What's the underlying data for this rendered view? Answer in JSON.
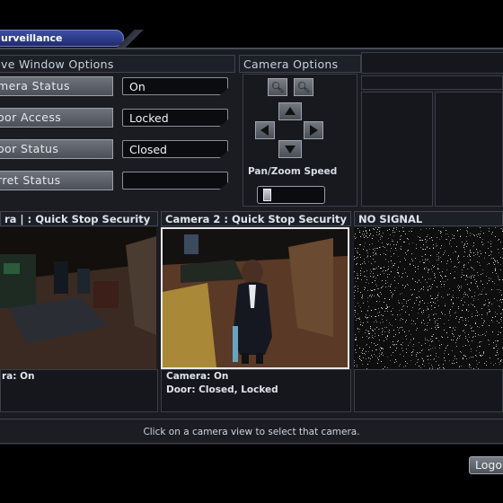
{
  "window": {
    "title": "urveillance"
  },
  "live_options": {
    "header": "ve Window Options",
    "rows": [
      {
        "label": "mera Status",
        "value": "On"
      },
      {
        "label": "oor Access",
        "value": "Locked"
      },
      {
        "label": "oor Status",
        "value": "Closed"
      },
      {
        "label": "rret Status",
        "value": ""
      }
    ]
  },
  "camera_options": {
    "header": "Camera Options",
    "zoom_in_icon": "magnifier-plus-icon",
    "zoom_out_icon": "magnifier-minus-icon",
    "speed_label": "Pan/Zoom Speed",
    "speed_level": 0.05
  },
  "cameras": [
    {
      "title": "ra | : Quick Stop Security",
      "status": "ra: On",
      "door": ""
    },
    {
      "title": "Camera 2 : Quick Stop Security",
      "status": "Camera: On",
      "door": "Door: Closed, Locked"
    },
    {
      "title": "NO SIGNAL",
      "status": "",
      "door": ""
    }
  ],
  "status_bar": {
    "hint": "Click on a camera view to select that camera."
  },
  "footer": {
    "logout_label": "Logo"
  },
  "colors": {
    "tab_blue": "#2f3c8c",
    "frame": "#1a1c22",
    "field_bg": "#0b0c10"
  }
}
